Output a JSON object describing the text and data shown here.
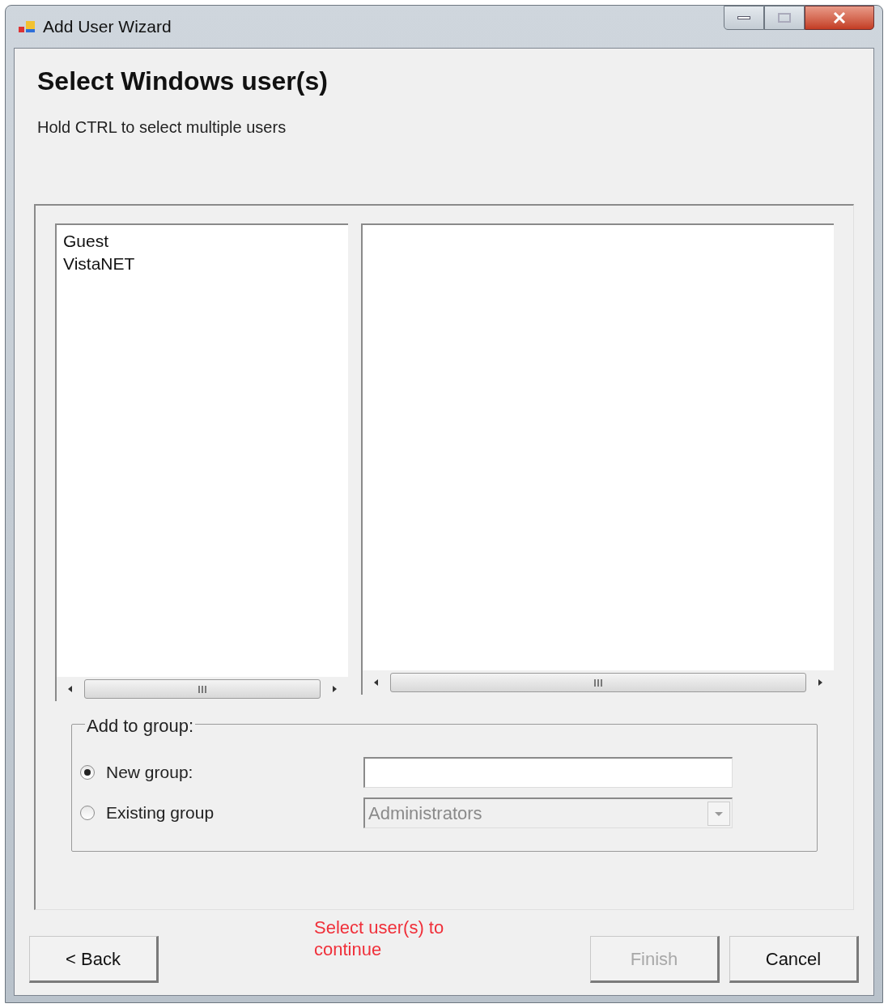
{
  "window": {
    "title": "Add User Wizard"
  },
  "header": {
    "title": "Select Windows user(s)",
    "subtitle": "Hold CTRL to select multiple users"
  },
  "users_list": {
    "items": [
      {
        "label": "Guest",
        "selected": false
      },
      {
        "label": "VistaNET",
        "selected": false
      }
    ]
  },
  "group": {
    "legend": "Add to group:",
    "options": [
      {
        "kind": "text",
        "label": "New group:",
        "selected": true,
        "disabled": false
      },
      {
        "kind": "dropdown",
        "label": "Existing group",
        "selected": false,
        "value": "Administrators",
        "disabled": true
      }
    ]
  },
  "message": "Select user(s) to continue",
  "buttons": [
    {
      "label": "< Back",
      "disabled": false
    },
    {
      "label": "Finish",
      "disabled": true
    },
    {
      "label": "Cancel",
      "disabled": false
    }
  ]
}
